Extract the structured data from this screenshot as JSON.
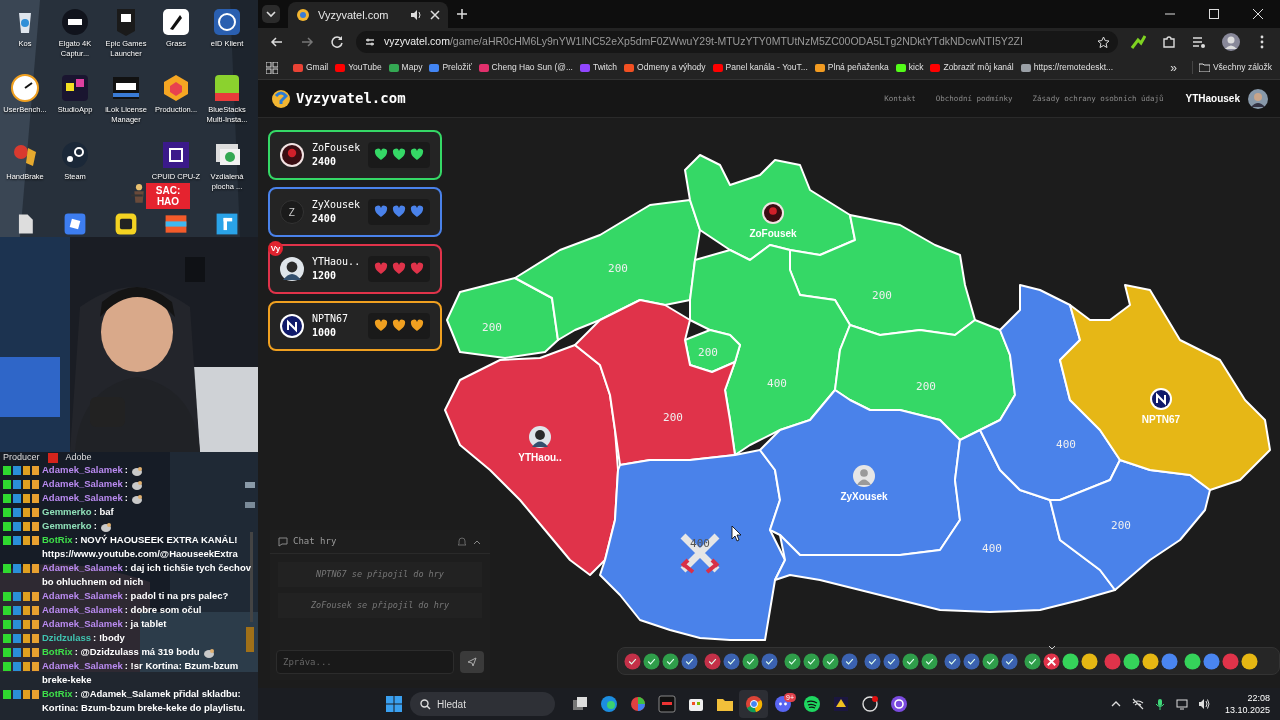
{
  "desktop": {
    "icons": [
      {
        "label": "Kos"
      },
      {
        "label": "Elgato 4K Captur..."
      },
      {
        "label": "Epic Games Launcher"
      },
      {
        "label": "Grass"
      },
      {
        "label": "eID Klient"
      },
      {
        "label": "UserBench..."
      },
      {
        "label": "StudioApp"
      },
      {
        "label": "iLok License Manager"
      },
      {
        "label": "Production..."
      },
      {
        "label": "BlueStacks Multi-Insta..."
      },
      {
        "label": "HandBrake"
      },
      {
        "label": "Steam"
      },
      {
        "label": "CPUID CPU-Z"
      },
      {
        "label": "Vzdialená plocha ..."
      }
    ],
    "sticker": "SAC: HAO"
  },
  "stream_chat": {
    "producer_label": "Producer",
    "adobe_label": "Adobe",
    "messages": [
      {
        "user": "Adamek_Salamek",
        "color": "#b98af0",
        "text": ":",
        "emote": true
      },
      {
        "user": "Adamek_Salamek",
        "color": "#b98af0",
        "text": ":",
        "emote": true
      },
      {
        "user": "Adamek_Salamek",
        "color": "#b98af0",
        "text": ":",
        "emote": true
      },
      {
        "user": "Gemmerko",
        "color": "#8fe0b8",
        "text": ": baf",
        "emote": false
      },
      {
        "user": "Gemmerko",
        "color": "#8fe0b8",
        "text": ":",
        "emote": true
      },
      {
        "user": "BotRix",
        "color": "#3ee04a",
        "text": ": NOVÝ HAOUSEEK EXTRA KANÁL! https://www.youtube.com/@HaouseekExtra",
        "emote": false
      },
      {
        "user": "Adamek_Salamek",
        "color": "#b98af0",
        "text": ": daj ich tichšie tych čechov bo ohluchnem od nich",
        "emote": false
      },
      {
        "user": "Adamek_Salamek",
        "color": "#b98af0",
        "text": ": padol ti na prs palec?",
        "emote": false
      },
      {
        "user": "Adamek_Salamek",
        "color": "#b98af0",
        "text": ": dobre som očul",
        "emote": false
      },
      {
        "user": "Adamek_Salamek",
        "color": "#b98af0",
        "text": ": ja tablet",
        "emote": false
      },
      {
        "user": "Dzidzulass",
        "color": "#3fc3b0",
        "text": ": !body",
        "emote": false
      },
      {
        "user": "BotRix",
        "color": "#3ee04a",
        "text": ": @Dzidzulass má 319 bodu",
        "emote": true
      },
      {
        "user": "Adamek_Salamek",
        "color": "#b98af0",
        "text": ": !sr Kortina: Bzum-bzum breke-keke",
        "emote": false
      },
      {
        "user": "BotRix",
        "color": "#3ee04a",
        "text": ": @Adamek_Salamek přidal skladbu: Kortina: Bzum-bzum breke-keke do playlistu.",
        "emote": false
      }
    ]
  },
  "browser": {
    "tab": {
      "title": "Vyzyvatel.com"
    },
    "url": {
      "host": "vyzyvatel.com",
      "path": "/game/aHR0cHM6Ly9nYW1INC52eXp5dmF0ZWwuY29t-MTUzYTY0MTUtNzM5ZC00ODA5LTg2NDktYTdkNDcwNTI5Y2ZI"
    },
    "bookmarks": [
      {
        "label": "Gmail",
        "color": "#ea4335"
      },
      {
        "label": "YouTube",
        "color": "#ff0000"
      },
      {
        "label": "Mapy",
        "color": "#34a853"
      },
      {
        "label": "Preložiť",
        "color": "#4285f4"
      },
      {
        "label": "Cheng Hao Sun (@...",
        "color": "#e1306c"
      },
      {
        "label": "Twitch",
        "color": "#9146ff"
      },
      {
        "label": "Odmeny a výhody",
        "color": "#f25022"
      },
      {
        "label": "Panel kanála - YouT...",
        "color": "#ff0000"
      },
      {
        "label": "Plná peňaženka",
        "color": "#f29b21"
      },
      {
        "label": "kick",
        "color": "#53fc18"
      },
      {
        "label": "Zobraziť môj kanál",
        "color": "#ff0000"
      },
      {
        "label": "https://remotedeskt...",
        "color": "#9aa0a6"
      }
    ],
    "more_bookmarks": "»",
    "all_bookmarks": "Všechny záložk"
  },
  "site": {
    "logo": "Vyzyvatel.com",
    "nav": [
      "Kontakt",
      "Obchodní podmínky",
      "Zásady ochrany osobních údajů"
    ],
    "user": "YTHaousek"
  },
  "players": [
    {
      "name": "ZoFousek",
      "score": "2400",
      "color": "#35d866",
      "avatar": {
        "kind": "mask"
      }
    },
    {
      "name": "ZyXousek",
      "score": "2400",
      "color": "#4a82ea",
      "avatar": {
        "kind": "initial",
        "initial": "Z"
      }
    },
    {
      "name": "YTHaou..",
      "score": "1200",
      "color": "#e0334a",
      "badge": "Vy"
    },
    {
      "name": "NPTN67",
      "score": "1000",
      "color": "#f0a020",
      "avatar": {
        "kind": "logo"
      }
    }
  ],
  "game_chat": {
    "title": "Chat hry",
    "messages": [
      "NPTN67 se připojil do hry",
      "ZoFousek se připojil do hry"
    ],
    "placeholder": "Zpráva..."
  },
  "map": {
    "regions": [
      {
        "color": "#35d866",
        "value": "200"
      },
      {
        "color": "#35d866",
        "value": "200"
      },
      {
        "color": "#35d866",
        "owner": {
          "name": "ZoFousek",
          "avatar": {
            "kind": "mask"
          }
        }
      },
      {
        "color": "#35d866",
        "value": "200"
      },
      {
        "color": "#35d866",
        "value": "400"
      },
      {
        "color": "#35d866",
        "value": "200"
      },
      {
        "color": "#35d866",
        "value": "200"
      },
      {
        "color": "#e0334a",
        "owner": {
          "name": "YTHaou.."
        }
      },
      {
        "color": "#e0334a",
        "value": "200"
      },
      {
        "color": "#4a82ea",
        "value": "400",
        "battle": true
      },
      {
        "color": "#4a82ea",
        "owner": {
          "name": "ZyXousek",
          "avatar": {
            "kind": "silhouette"
          }
        }
      },
      {
        "color": "#4a82ea",
        "value": "400"
      },
      {
        "color": "#4a82ea",
        "value": "400"
      },
      {
        "color": "#4a82ea",
        "value": "200"
      },
      {
        "color": "#e6b716",
        "owner": {
          "name": "NPTN67",
          "avatar": {
            "kind": "logo"
          }
        }
      }
    ]
  },
  "rounds": [
    [
      {
        "kind": "done",
        "color": "#c43048"
      },
      {
        "kind": "done",
        "color": "#2f9e4a"
      },
      {
        "kind": "done",
        "color": "#2f9e4a"
      },
      {
        "kind": "done",
        "color": "#3b62b0"
      }
    ],
    [
      {
        "kind": "done",
        "color": "#c43048"
      },
      {
        "kind": "done",
        "color": "#3b62b0"
      },
      {
        "kind": "done",
        "color": "#2f9e4a"
      },
      {
        "kind": "done",
        "color": "#3b62b0"
      }
    ],
    [
      {
        "kind": "done",
        "color": "#2f9e4a"
      },
      {
        "kind": "done",
        "color": "#2f9e4a"
      },
      {
        "kind": "done",
        "color": "#2f9e4a"
      },
      {
        "kind": "done",
        "color": "#3b62b0"
      }
    ],
    [
      {
        "kind": "done",
        "color": "#3b62b0"
      },
      {
        "kind": "done",
        "color": "#3b62b0"
      },
      {
        "kind": "done",
        "color": "#2f9e4a"
      },
      {
        "kind": "done",
        "color": "#2f9e4a"
      }
    ],
    [
      {
        "kind": "done",
        "color": "#3b62b0"
      },
      {
        "kind": "done",
        "color": "#3b62b0"
      },
      {
        "kind": "done",
        "color": "#2f9e4a"
      },
      {
        "kind": "done",
        "color": "#3b62b0"
      }
    ],
    [
      {
        "kind": "done",
        "color": "#2f9e4a"
      },
      {
        "kind": "current",
        "color": "#e0334a"
      },
      {
        "kind": "upcoming",
        "color": "#35d35a"
      },
      {
        "kind": "upcoming",
        "color": "#e6b713"
      }
    ],
    [
      {
        "kind": "upcoming",
        "color": "#e0334a"
      },
      {
        "kind": "upcoming",
        "color": "#35d35a"
      },
      {
        "kind": "upcoming",
        "color": "#e6b713"
      },
      {
        "kind": "upcoming",
        "color": "#4a85f0"
      }
    ],
    [
      {
        "kind": "upcoming",
        "color": "#35d35a"
      },
      {
        "kind": "upcoming",
        "color": "#4a85f0"
      },
      {
        "kind": "upcoming",
        "color": "#e0334a"
      },
      {
        "kind": "upcoming",
        "color": "#e6b713"
      }
    ]
  ],
  "taskbar": {
    "search_placeholder": "Hledat",
    "discord_badge": "9+",
    "time": "22:08",
    "date": "13.10.2025"
  }
}
